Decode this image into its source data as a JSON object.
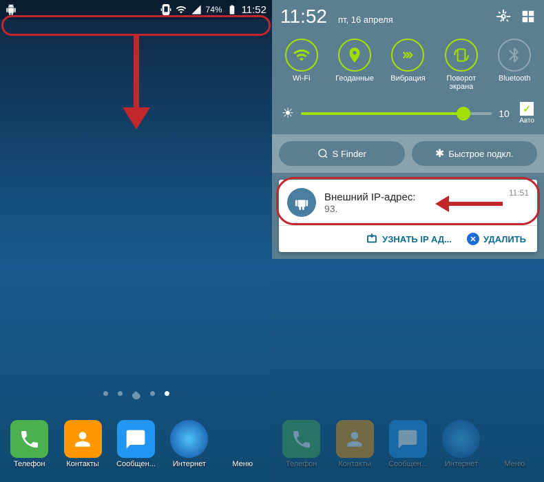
{
  "status": {
    "time": "11:52",
    "battery": "74%"
  },
  "panel": {
    "time": "11:52",
    "date": "пт, 16 апреля",
    "brightness_value": "10",
    "auto_label": "Авто",
    "sfinder": "S Finder",
    "quick_connect": "Быстрое подкл."
  },
  "toggles": [
    {
      "label": "Wi-Fi"
    },
    {
      "label": "Геоданные"
    },
    {
      "label": "Вибрация"
    },
    {
      "label": "Поворот\nэкрана"
    },
    {
      "label": "Bluetooth"
    }
  ],
  "notification": {
    "title": "Внешний IP-адрес:",
    "subtitle": "93.",
    "time": "11:51",
    "action_learn": "УЗНАТЬ IP АД...",
    "action_delete": "УДАЛИТЬ"
  },
  "dock": [
    {
      "label": "Телефон"
    },
    {
      "label": "Контакты"
    },
    {
      "label": "Сообщен..."
    },
    {
      "label": "Интернет"
    },
    {
      "label": "Меню"
    }
  ]
}
